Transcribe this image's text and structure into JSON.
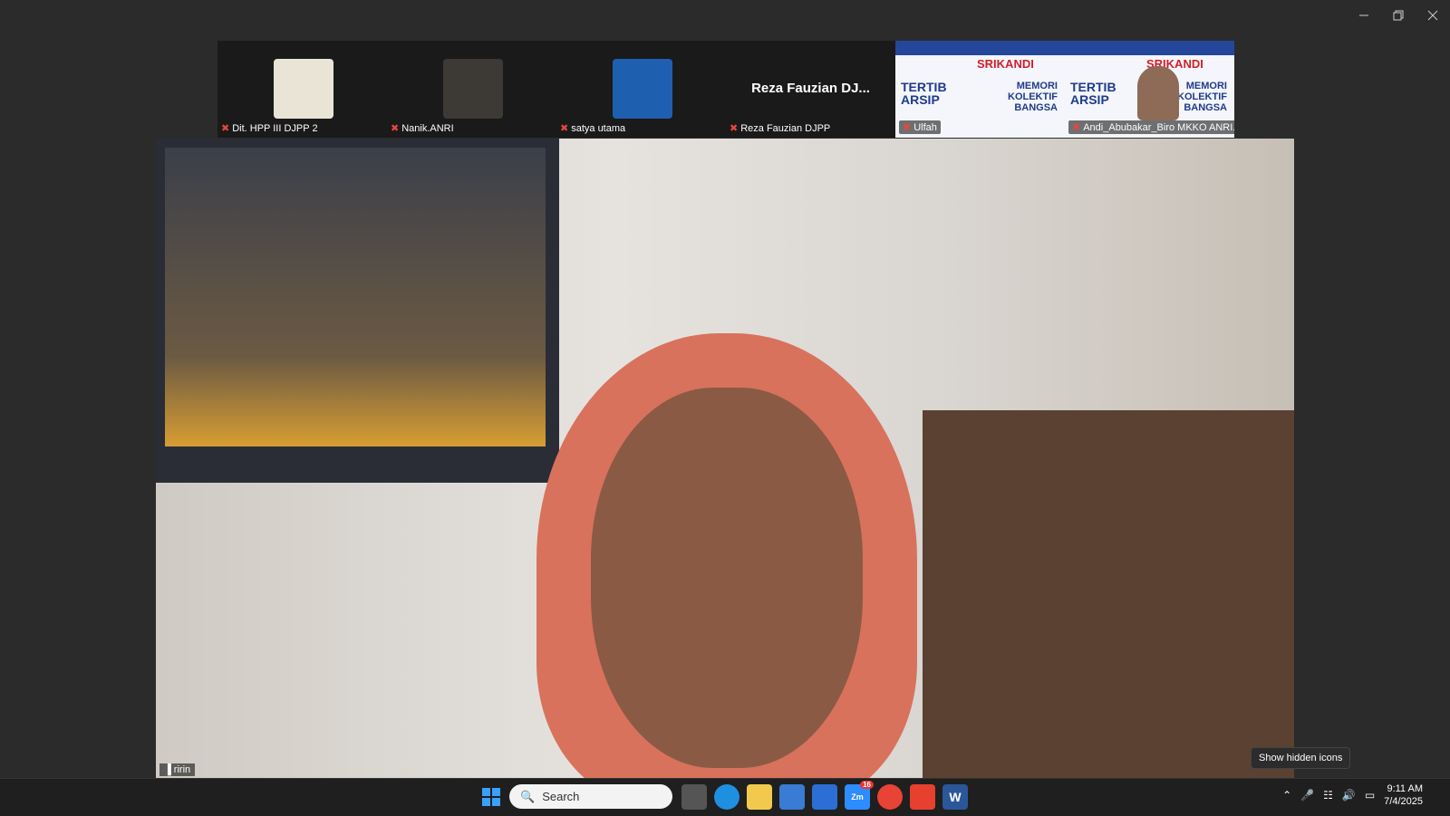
{
  "participants": [
    {
      "name": "Dit. HPP III DJPP 2",
      "muted": true
    },
    {
      "name": "Nanik.ANRI",
      "muted": true
    },
    {
      "name": "satya utama",
      "muted": true
    },
    {
      "name": "Reza Fauzian DJPP",
      "muted": true,
      "display_label": "Reza Fauzian DJ..."
    },
    {
      "name": "Ulfah",
      "muted": true
    },
    {
      "name": "Andi_Abubakar_Biro MKKO ANRI...",
      "muted": true
    }
  ],
  "banner": {
    "title": "SRIKANDI",
    "line1": "TERTIB",
    "line2": "ARSIP",
    "line3": "MEMORI",
    "line4": "KOLEKTIF",
    "line5": "BANGSA"
  },
  "main_speaker": {
    "name": "ririn"
  },
  "tooltip": "Show hidden icons",
  "taskbar": {
    "search_placeholder": "Search",
    "zoom_badge": "16",
    "time": "9:11 AM",
    "date": "7/4/2025"
  },
  "colors": {
    "muted_mic": "#e8473f",
    "taskbar": "#1f1f1f",
    "background": "#2b2b2b"
  }
}
